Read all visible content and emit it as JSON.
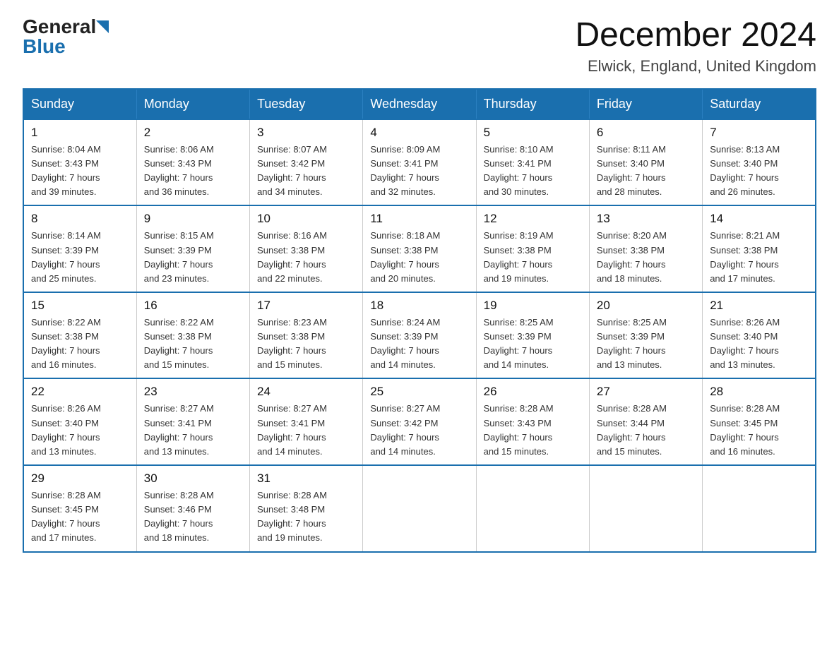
{
  "header": {
    "logo_general": "General",
    "logo_blue": "Blue",
    "month_year": "December 2024",
    "location": "Elwick, England, United Kingdom"
  },
  "days_of_week": [
    "Sunday",
    "Monday",
    "Tuesday",
    "Wednesday",
    "Thursday",
    "Friday",
    "Saturday"
  ],
  "weeks": [
    [
      {
        "day": "1",
        "sunrise": "8:04 AM",
        "sunset": "3:43 PM",
        "daylight": "7 hours and 39 minutes."
      },
      {
        "day": "2",
        "sunrise": "8:06 AM",
        "sunset": "3:43 PM",
        "daylight": "7 hours and 36 minutes."
      },
      {
        "day": "3",
        "sunrise": "8:07 AM",
        "sunset": "3:42 PM",
        "daylight": "7 hours and 34 minutes."
      },
      {
        "day": "4",
        "sunrise": "8:09 AM",
        "sunset": "3:41 PM",
        "daylight": "7 hours and 32 minutes."
      },
      {
        "day": "5",
        "sunrise": "8:10 AM",
        "sunset": "3:41 PM",
        "daylight": "7 hours and 30 minutes."
      },
      {
        "day": "6",
        "sunrise": "8:11 AM",
        "sunset": "3:40 PM",
        "daylight": "7 hours and 28 minutes."
      },
      {
        "day": "7",
        "sunrise": "8:13 AM",
        "sunset": "3:40 PM",
        "daylight": "7 hours and 26 minutes."
      }
    ],
    [
      {
        "day": "8",
        "sunrise": "8:14 AM",
        "sunset": "3:39 PM",
        "daylight": "7 hours and 25 minutes."
      },
      {
        "day": "9",
        "sunrise": "8:15 AM",
        "sunset": "3:39 PM",
        "daylight": "7 hours and 23 minutes."
      },
      {
        "day": "10",
        "sunrise": "8:16 AM",
        "sunset": "3:38 PM",
        "daylight": "7 hours and 22 minutes."
      },
      {
        "day": "11",
        "sunrise": "8:18 AM",
        "sunset": "3:38 PM",
        "daylight": "7 hours and 20 minutes."
      },
      {
        "day": "12",
        "sunrise": "8:19 AM",
        "sunset": "3:38 PM",
        "daylight": "7 hours and 19 minutes."
      },
      {
        "day": "13",
        "sunrise": "8:20 AM",
        "sunset": "3:38 PM",
        "daylight": "7 hours and 18 minutes."
      },
      {
        "day": "14",
        "sunrise": "8:21 AM",
        "sunset": "3:38 PM",
        "daylight": "7 hours and 17 minutes."
      }
    ],
    [
      {
        "day": "15",
        "sunrise": "8:22 AM",
        "sunset": "3:38 PM",
        "daylight": "7 hours and 16 minutes."
      },
      {
        "day": "16",
        "sunrise": "8:22 AM",
        "sunset": "3:38 PM",
        "daylight": "7 hours and 15 minutes."
      },
      {
        "day": "17",
        "sunrise": "8:23 AM",
        "sunset": "3:38 PM",
        "daylight": "7 hours and 15 minutes."
      },
      {
        "day": "18",
        "sunrise": "8:24 AM",
        "sunset": "3:39 PM",
        "daylight": "7 hours and 14 minutes."
      },
      {
        "day": "19",
        "sunrise": "8:25 AM",
        "sunset": "3:39 PM",
        "daylight": "7 hours and 14 minutes."
      },
      {
        "day": "20",
        "sunrise": "8:25 AM",
        "sunset": "3:39 PM",
        "daylight": "7 hours and 13 minutes."
      },
      {
        "day": "21",
        "sunrise": "8:26 AM",
        "sunset": "3:40 PM",
        "daylight": "7 hours and 13 minutes."
      }
    ],
    [
      {
        "day": "22",
        "sunrise": "8:26 AM",
        "sunset": "3:40 PM",
        "daylight": "7 hours and 13 minutes."
      },
      {
        "day": "23",
        "sunrise": "8:27 AM",
        "sunset": "3:41 PM",
        "daylight": "7 hours and 13 minutes."
      },
      {
        "day": "24",
        "sunrise": "8:27 AM",
        "sunset": "3:41 PM",
        "daylight": "7 hours and 14 minutes."
      },
      {
        "day": "25",
        "sunrise": "8:27 AM",
        "sunset": "3:42 PM",
        "daylight": "7 hours and 14 minutes."
      },
      {
        "day": "26",
        "sunrise": "8:28 AM",
        "sunset": "3:43 PM",
        "daylight": "7 hours and 15 minutes."
      },
      {
        "day": "27",
        "sunrise": "8:28 AM",
        "sunset": "3:44 PM",
        "daylight": "7 hours and 15 minutes."
      },
      {
        "day": "28",
        "sunrise": "8:28 AM",
        "sunset": "3:45 PM",
        "daylight": "7 hours and 16 minutes."
      }
    ],
    [
      {
        "day": "29",
        "sunrise": "8:28 AM",
        "sunset": "3:45 PM",
        "daylight": "7 hours and 17 minutes."
      },
      {
        "day": "30",
        "sunrise": "8:28 AM",
        "sunset": "3:46 PM",
        "daylight": "7 hours and 18 minutes."
      },
      {
        "day": "31",
        "sunrise": "8:28 AM",
        "sunset": "3:48 PM",
        "daylight": "7 hours and 19 minutes."
      },
      null,
      null,
      null,
      null
    ]
  ],
  "labels": {
    "sunrise": "Sunrise:",
    "sunset": "Sunset:",
    "daylight": "Daylight:"
  }
}
